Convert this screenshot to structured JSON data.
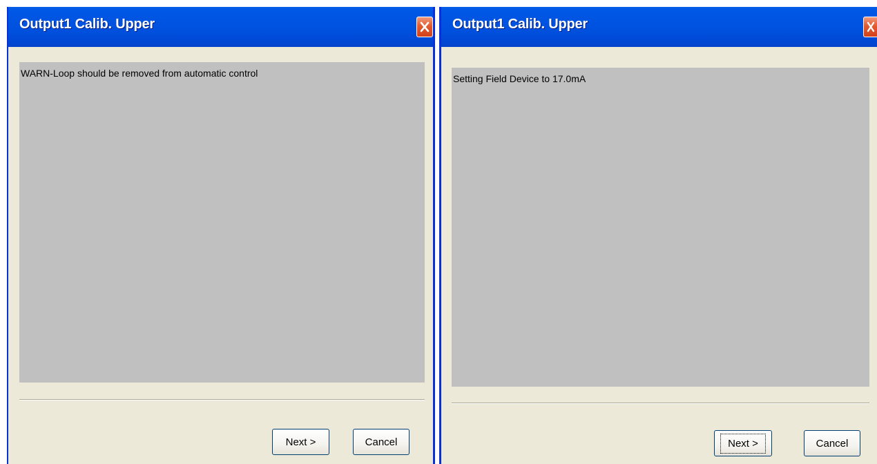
{
  "dialogs": [
    {
      "title": "Output1 Calib. Upper",
      "message": "WARN-Loop should be removed from automatic control",
      "buttons": {
        "next": "Next >",
        "cancel": "Cancel"
      },
      "close_icon": "close-icon"
    },
    {
      "title": "Output1 Calib. Upper",
      "message": "Setting Field Device to 17.0mA",
      "buttons": {
        "next": "Next >",
        "cancel": "Cancel"
      },
      "close_icon": "close-icon",
      "focused_button": "next"
    }
  ],
  "colors": {
    "titlebar": "#0054e3",
    "window_face": "#ece9d8",
    "message_panel": "#c0c0c0",
    "close_button": "#e35b2f",
    "button_border": "#003c74"
  }
}
